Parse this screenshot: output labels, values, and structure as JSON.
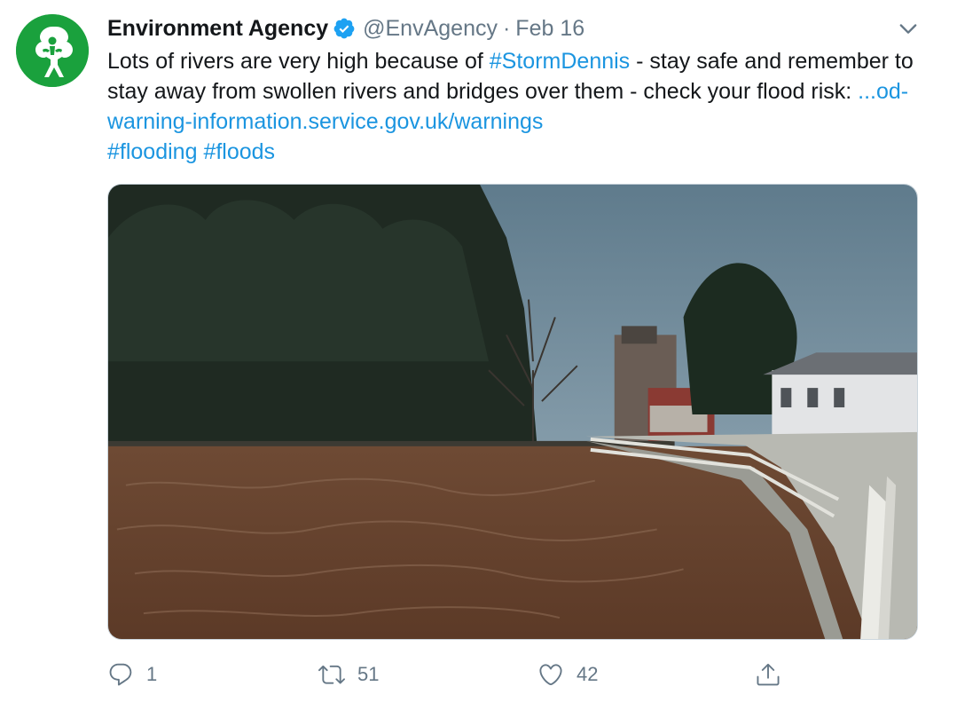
{
  "tweet": {
    "author_name": "Environment Agency",
    "handle": "@EnvAgency",
    "separator": "·",
    "date": "Feb 16",
    "text_parts": {
      "t1": "Lots of rivers are very high because of ",
      "h1": "#StormDennis",
      "t2": " - stay safe and remember to stay away from swollen rivers and bridges over them - check your flood risk: ",
      "url": "...od-warning-information.service.gov.uk/warnings",
      "h2": "#flooding",
      "h3": "#floods"
    },
    "media_description_icon": "flooded-river-photo"
  },
  "actions": {
    "reply_count": "1",
    "retweet_count": "51",
    "like_count": "42"
  },
  "icons": {
    "avatar": "tree-person-logo-icon",
    "verified": "verified-badge-icon",
    "menu": "chevron-down-icon",
    "reply": "reply-icon",
    "retweet": "retweet-icon",
    "like": "heart-icon",
    "share": "share-icon"
  },
  "colors": {
    "brand_green": "#1aa13d",
    "link_blue": "#1b95e0",
    "muted_gray": "#657786",
    "text": "#14171a"
  }
}
